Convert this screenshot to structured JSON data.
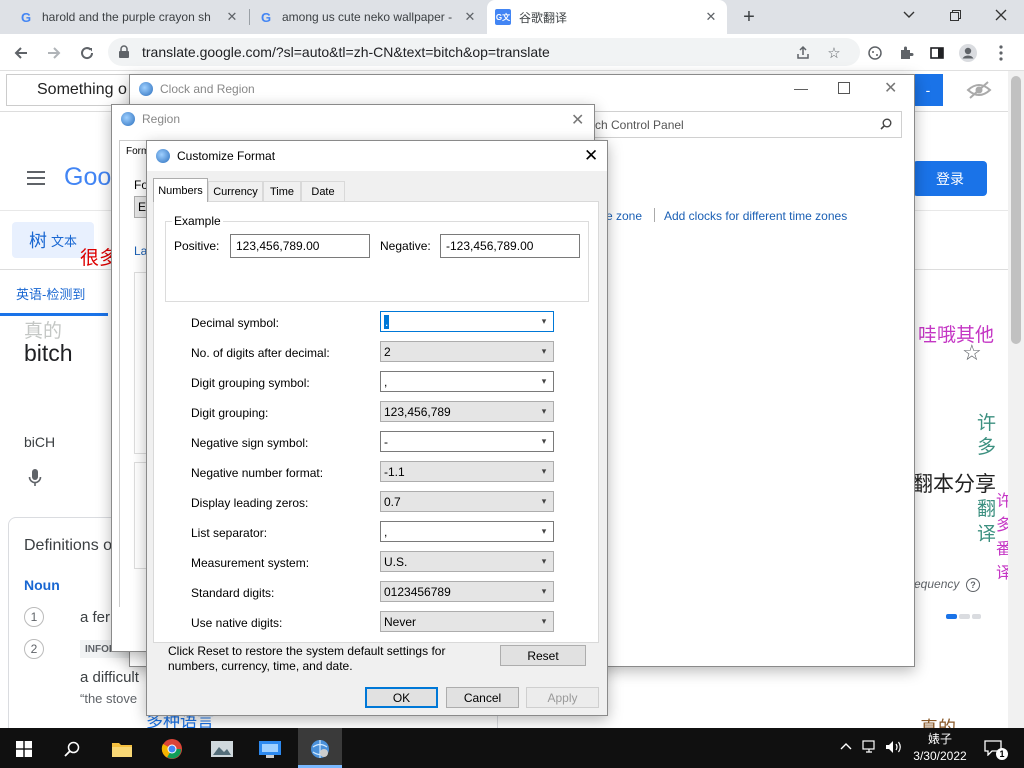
{
  "browser": {
    "tabs": [
      {
        "title": "harold and the purple crayon sh",
        "icon": "G",
        "close": "✕"
      },
      {
        "title": "among us cute neko wallpaper -",
        "icon": "G",
        "close": "✕"
      },
      {
        "title": "谷歌翻译",
        "icon": "G文",
        "close": "✕"
      }
    ],
    "new_tab": "+",
    "url": "translate.google.com/?sl=auto&tl=zh-CN&text=bitch&op=translate"
  },
  "page": {
    "search_text": "Something o",
    "logo": "Goog",
    "login_button": "登录",
    "mode_tab": "文本",
    "mode_icon": "树",
    "lang_detected": "英语-检测到",
    "source_word": "bitch",
    "faded_word": "真的",
    "phonetic": "biCH",
    "definitions_title": "Definitions o",
    "pos": "Noun",
    "def1_num": "1",
    "def1": "a fer",
    "def2_num": "2",
    "def2_tag": "INFORM",
    "def2": "a difficult",
    "example": "“the stove",
    "search_cp": "ch Control Panel",
    "link_timezone": "e zone",
    "link_clocks": "Add clocks for different time zones",
    "frequency": "requency",
    "right_text": "哇哦其他",
    "share_text": "翻本分享",
    "side_chars": [
      "许",
      "多",
      "翻",
      "译"
    ],
    "pink_chars": [
      "许",
      "多",
      "番",
      "译"
    ],
    "bottom_text": "多种语言",
    "bottom_right": "真的",
    "red_text": "很多",
    "link_la": "La"
  },
  "clock_region": {
    "title": "Clock and Region"
  },
  "region": {
    "title": "Region",
    "tab_label": "Form",
    "fo": "Fo",
    "e": "E"
  },
  "customize": {
    "title": "Customize Format",
    "tabs": [
      "Numbers",
      "Currency",
      "Time",
      "Date"
    ],
    "example_label": "Example",
    "positive_label": "Positive:",
    "positive_value": "123,456,789.00",
    "negative_label": "Negative:",
    "negative_value": "-123,456,789.00",
    "rows": [
      {
        "label": "Decimal symbol:",
        "value": ".",
        "editable": true,
        "focused": true
      },
      {
        "label": "No. of digits after decimal:",
        "value": "2",
        "editable": false
      },
      {
        "label": "Digit grouping symbol:",
        "value": ",",
        "editable": true
      },
      {
        "label": "Digit grouping:",
        "value": "123,456,789",
        "editable": false
      },
      {
        "label": "Negative sign symbol:",
        "value": "-",
        "editable": true
      },
      {
        "label": "Negative number format:",
        "value": "-1.1",
        "editable": false
      },
      {
        "label": "Display leading zeros:",
        "value": "0.7",
        "editable": false
      },
      {
        "label": "List separator:",
        "value": ",",
        "editable": true
      },
      {
        "label": "Measurement system:",
        "value": "U.S.",
        "editable": false
      },
      {
        "label": "Standard digits:",
        "value": "0123456789",
        "editable": false
      },
      {
        "label": "Use native digits:",
        "value": "Never",
        "editable": false
      }
    ],
    "reset_note": "Click Reset to restore the system default settings for numbers, currency, time, and date.",
    "reset_button": "Reset",
    "ok_button": "OK",
    "cancel_button": "Cancel",
    "apply_button": "Apply"
  },
  "taskbar": {
    "clock_time": "婊子",
    "clock_date": "3/30/2022",
    "notification_count": "1"
  },
  "colors": {
    "accent": "#0078d7",
    "google_blue": "#1a73e8",
    "taskbar": "#101010"
  }
}
